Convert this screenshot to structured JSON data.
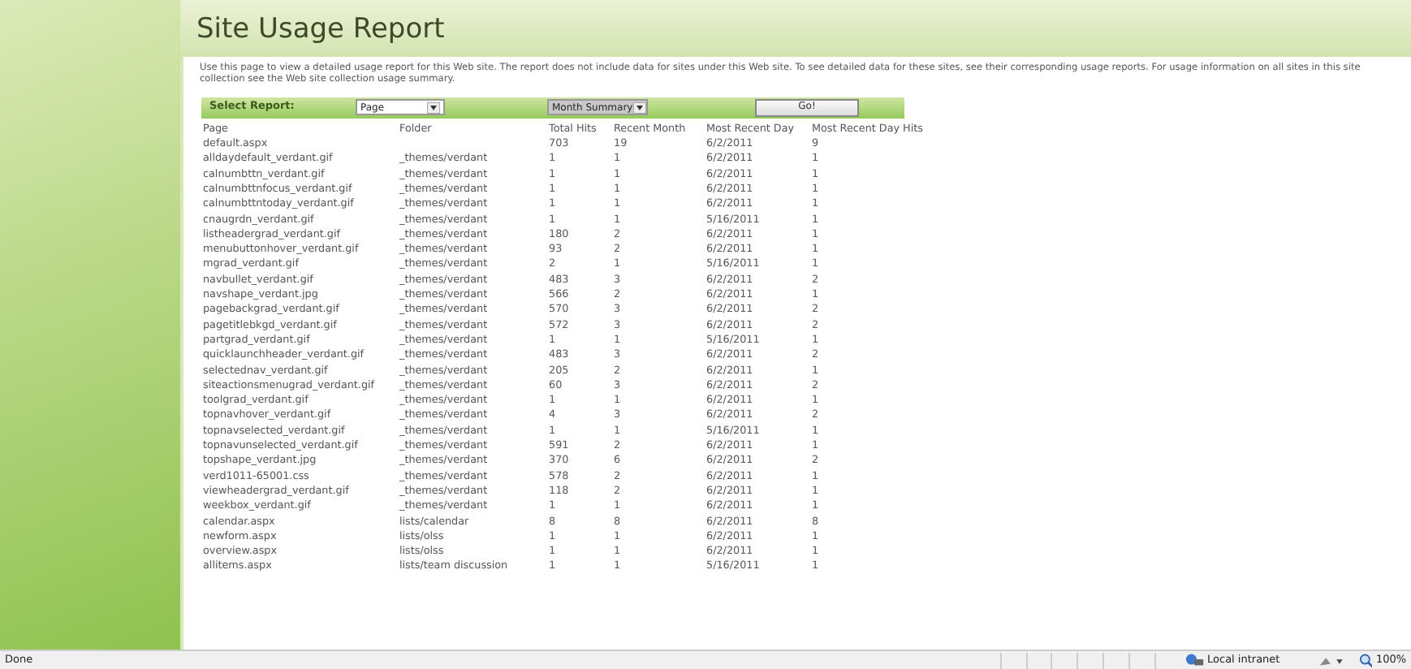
{
  "page_title": "Site Usage Report",
  "description": "Use this page to view a detailed usage report for this Web site. The report does not include data for sites under this Web site. To see detailed data for these sites, see their corresponding usage reports. For usage information on all sites in this site collection see the Web site collection usage summary.",
  "report_bar": {
    "label": "Select Report:",
    "report_select": "Page",
    "period_select": "Month Summary",
    "go_button": "Go!"
  },
  "table": {
    "columns": [
      "Page",
      "Folder",
      "Total Hits",
      "Recent Month",
      "Most Recent Day",
      "Most Recent Day Hits"
    ],
    "rows": [
      [
        "default.aspx",
        "",
        "703",
        "19",
        "6/2/2011",
        "9"
      ],
      [
        "alldaydefault_verdant.gif",
        "_themes/verdant",
        "1",
        "1",
        "6/2/2011",
        "1"
      ],
      [
        "calnumbttn_verdant.gif",
        "_themes/verdant",
        "1",
        "1",
        "6/2/2011",
        "1"
      ],
      [
        "calnumbttnfocus_verdant.gif",
        "_themes/verdant",
        "1",
        "1",
        "6/2/2011",
        "1"
      ],
      [
        "calnumbttntoday_verdant.gif",
        "_themes/verdant",
        "1",
        "1",
        "6/2/2011",
        "1"
      ],
      [
        "cnaugrdn_verdant.gif",
        "_themes/verdant",
        "1",
        "1",
        "5/16/2011",
        "1"
      ],
      [
        "listheadergrad_verdant.gif",
        "_themes/verdant",
        "180",
        "2",
        "6/2/2011",
        "1"
      ],
      [
        "menubuttonhover_verdant.gif",
        "_themes/verdant",
        "93",
        "2",
        "6/2/2011",
        "1"
      ],
      [
        "mgrad_verdant.gif",
        "_themes/verdant",
        "2",
        "1",
        "5/16/2011",
        "1"
      ],
      [
        "navbullet_verdant.gif",
        "_themes/verdant",
        "483",
        "3",
        "6/2/2011",
        "2"
      ],
      [
        "navshape_verdant.jpg",
        "_themes/verdant",
        "566",
        "2",
        "6/2/2011",
        "1"
      ],
      [
        "pagebackgrad_verdant.gif",
        "_themes/verdant",
        "570",
        "3",
        "6/2/2011",
        "2"
      ],
      [
        "pagetitlebkgd_verdant.gif",
        "_themes/verdant",
        "572",
        "3",
        "6/2/2011",
        "2"
      ],
      [
        "partgrad_verdant.gif",
        "_themes/verdant",
        "1",
        "1",
        "5/16/2011",
        "1"
      ],
      [
        "quicklaunchheader_verdant.gif",
        "_themes/verdant",
        "483",
        "3",
        "6/2/2011",
        "2"
      ],
      [
        "selectednav_verdant.gif",
        "_themes/verdant",
        "205",
        "2",
        "6/2/2011",
        "1"
      ],
      [
        "siteactionsmenugrad_verdant.gif",
        "_themes/verdant",
        "60",
        "3",
        "6/2/2011",
        "2"
      ],
      [
        "toolgrad_verdant.gif",
        "_themes/verdant",
        "1",
        "1",
        "6/2/2011",
        "1"
      ],
      [
        "topnavhover_verdant.gif",
        "_themes/verdant",
        "4",
        "3",
        "6/2/2011",
        "2"
      ],
      [
        "topnavselected_verdant.gif",
        "_themes/verdant",
        "1",
        "1",
        "5/16/2011",
        "1"
      ],
      [
        "topnavunselected_verdant.gif",
        "_themes/verdant",
        "591",
        "2",
        "6/2/2011",
        "1"
      ],
      [
        "topshape_verdant.jpg",
        "_themes/verdant",
        "370",
        "6",
        "6/2/2011",
        "2"
      ],
      [
        "verd1011-65001.css",
        "_themes/verdant",
        "578",
        "2",
        "6/2/2011",
        "1"
      ],
      [
        "viewheadergrad_verdant.gif",
        "_themes/verdant",
        "118",
        "2",
        "6/2/2011",
        "1"
      ],
      [
        "weekbox_verdant.gif",
        "_themes/verdant",
        "1",
        "1",
        "6/2/2011",
        "1"
      ],
      [
        "calendar.aspx",
        "lists/calendar",
        "8",
        "8",
        "6/2/2011",
        "8"
      ],
      [
        "newform.aspx",
        "lists/olss",
        "1",
        "1",
        "6/2/2011",
        "1"
      ],
      [
        "overview.aspx",
        "lists/olss",
        "1",
        "1",
        "6/2/2011",
        "1"
      ],
      [
        "allitems.aspx",
        "lists/team discussion",
        "1",
        "1",
        "5/16/2011",
        "1"
      ]
    ]
  },
  "status_bar": {
    "status": "Done",
    "zone": "Local intranet",
    "zoom": "100%"
  }
}
